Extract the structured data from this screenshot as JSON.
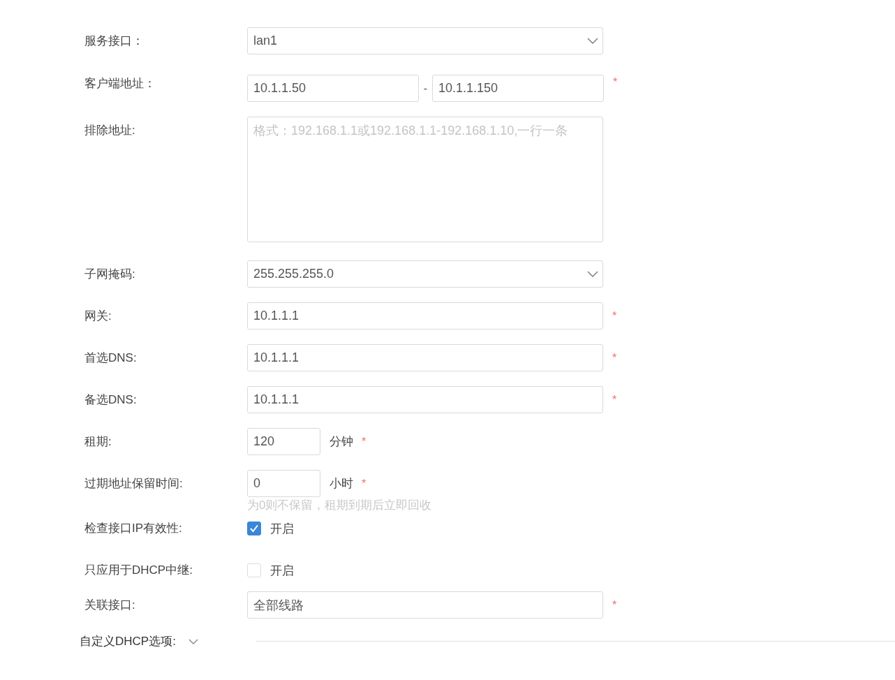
{
  "fields": [
    {
      "kind": "select",
      "label": "服务接口：",
      "value": "lan1"
    },
    {
      "kind": "range",
      "label": "客户端地址：",
      "from": "10.1.1.50",
      "separator": "-",
      "to": "10.1.1.150",
      "required_mark": "*"
    },
    {
      "kind": "textarea",
      "label": "排除地址:",
      "placeholder": "格式：192.168.1.1或192.168.1.1-192.168.1.10,一行一条"
    },
    {
      "kind": "select",
      "label": "子网掩码:",
      "value": "255.255.255.0"
    },
    {
      "kind": "text",
      "label": "网关:",
      "value": "10.1.1.1",
      "required_mark": "*"
    },
    {
      "kind": "text",
      "label": "首选DNS:",
      "value": "10.1.1.1",
      "required_mark": "*"
    },
    {
      "kind": "text",
      "label": "备选DNS:",
      "value": "10.1.1.1",
      "required_mark": "*"
    },
    {
      "kind": "short",
      "label": "租期:",
      "value": "120",
      "unit": "分钟",
      "required_mark": "*"
    },
    {
      "kind": "short",
      "label": "过期地址保留时间:",
      "value": "0",
      "unit": "小时",
      "required_mark": "*",
      "hint": "为0则不保留，租期到期后立即回收"
    },
    {
      "kind": "checkbox",
      "label": "检查接口IP有效性:",
      "checked": true,
      "option": "开启"
    },
    {
      "kind": "checkbox",
      "label": "只应用于DHCP中继:",
      "checked": false,
      "option": "开启"
    },
    {
      "kind": "text",
      "label": "关联接口:",
      "value": "全部线路",
      "required_mark": "*"
    }
  ],
  "section": {
    "label": "自定义DHCP选项:",
    "expanded": false
  }
}
